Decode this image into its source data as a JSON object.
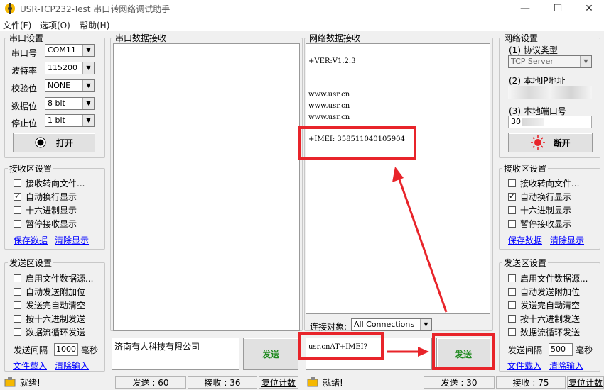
{
  "window": {
    "title": "USR-TCP232-Test 串口转网络调试助手",
    "controls": [
      "minimize-icon",
      "maximize-icon",
      "close-icon"
    ]
  },
  "menu": [
    "文件(F)",
    "选项(O)",
    "帮助(H)"
  ],
  "serial_settings": {
    "legend": "串口设置",
    "fields": [
      {
        "label": "串口号",
        "value": "COM11"
      },
      {
        "label": "波特率",
        "value": "115200"
      },
      {
        "label": "校验位",
        "value": "NONE"
      },
      {
        "label": "数据位",
        "value": "8 bit"
      },
      {
        "label": "停止位",
        "value": "1 bit"
      }
    ],
    "open_button": "打开"
  },
  "recv_settings_left": {
    "legend": "接收区设置",
    "options": [
      {
        "label": "接收转向文件...",
        "checked": false
      },
      {
        "label": "自动换行显示",
        "checked": true
      },
      {
        "label": "十六进制显示",
        "checked": false
      },
      {
        "label": "暂停接收显示",
        "checked": false
      }
    ],
    "save_link": "保存数据",
    "clear_link": "清除显示"
  },
  "send_settings_left": {
    "legend": "发送区设置",
    "options": [
      {
        "label": "启用文件数据源...",
        "checked": false
      },
      {
        "label": "自动发送附加位",
        "checked": false
      },
      {
        "label": "发送完自动清空",
        "checked": false
      },
      {
        "label": "按十六进制发送",
        "checked": false
      },
      {
        "label": "数据流循环发送",
        "checked": false
      }
    ],
    "interval_label": "发送间隔",
    "interval_value": "1000",
    "interval_unit": "毫秒",
    "load_link": "文件载入",
    "clear_link": "清除输入"
  },
  "serial_recv": {
    "legend": "串口数据接收",
    "send_input": "济南有人科技有限公司",
    "send_button": "发送"
  },
  "net_recv": {
    "legend": "网络数据接收",
    "lines": [
      "+VER:V1.2.3",
      "www.usr.cn",
      "www.usr.cn",
      "www.usr.cn",
      "+IMEI: 358511040105904"
    ],
    "conn_label": "连接对象:",
    "conn_value": "All Connections",
    "send_input": "usr.cnAT+IMEI?",
    "send_button": "发送"
  },
  "net_settings": {
    "legend": "网络设置",
    "protocol_label": "(1) 协议类型",
    "protocol_value": "TCP Server",
    "ip_label": "(2) 本地IP地址",
    "port_label": "(3) 本地端口号",
    "port_value": "30",
    "close_button": "断开"
  },
  "recv_settings_right": {
    "legend": "接收区设置",
    "options": [
      {
        "label": "接收转向文件...",
        "checked": false
      },
      {
        "label": "自动换行显示",
        "checked": true
      },
      {
        "label": "十六进制显示",
        "checked": false
      },
      {
        "label": "暂停接收显示",
        "checked": false
      }
    ],
    "save_link": "保存数据",
    "clear_link": "清除显示"
  },
  "send_settings_right": {
    "legend": "发送区设置",
    "options": [
      {
        "label": "启用文件数据源...",
        "checked": false
      },
      {
        "label": "自动发送附加位",
        "checked": false
      },
      {
        "label": "发送完自动清空",
        "checked": false
      },
      {
        "label": "按十六进制发送",
        "checked": false
      },
      {
        "label": "数据流循环发送",
        "checked": false
      }
    ],
    "interval_label": "发送间隔",
    "interval_value": "500",
    "interval_unit": "毫秒",
    "load_link": "文件载入",
    "clear_link": "清除输入"
  },
  "status_left": {
    "ready": "就绪!",
    "sent": "发送 : 60",
    "recv": "接收 : 36",
    "reset": "复位计数"
  },
  "status_right": {
    "ready": "就绪!",
    "sent": "发送 : 30",
    "recv": "接收 : 75",
    "reset": "复位计数"
  },
  "check_mark": "✓",
  "colors": {
    "annotation_red": "#e8242a",
    "send_button_green": "#1f8a1f",
    "link_blue": "#0000ff"
  }
}
